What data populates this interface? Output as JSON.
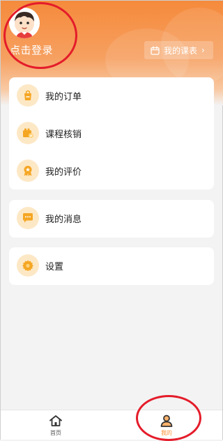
{
  "header": {
    "login_text": "点击登录",
    "schedule_label": "我的课表",
    "schedule_chevron": "›"
  },
  "menu": {
    "orders": "我的订单",
    "course_verify": "课程核销",
    "reviews": "我的评价",
    "messages": "我的消息",
    "settings": "设置"
  },
  "tabbar": {
    "home": "首页",
    "mine": "我的"
  },
  "colors": {
    "accent": "#f58a3b",
    "icon_bg": "#fde8c6",
    "icon_fg": "#f5a623",
    "active_tab": "#ff8f33",
    "annotation": "#e41c2a"
  },
  "icons": {
    "avatar": "cartoon-boy-avatar",
    "schedule": "calendar-icon",
    "orders": "order-bag-icon",
    "course_verify": "ticket-check-icon",
    "reviews": "medal-star-icon",
    "messages": "chat-bubble-icon",
    "settings": "gear-icon",
    "home": "home-icon",
    "mine": "person-icon"
  }
}
